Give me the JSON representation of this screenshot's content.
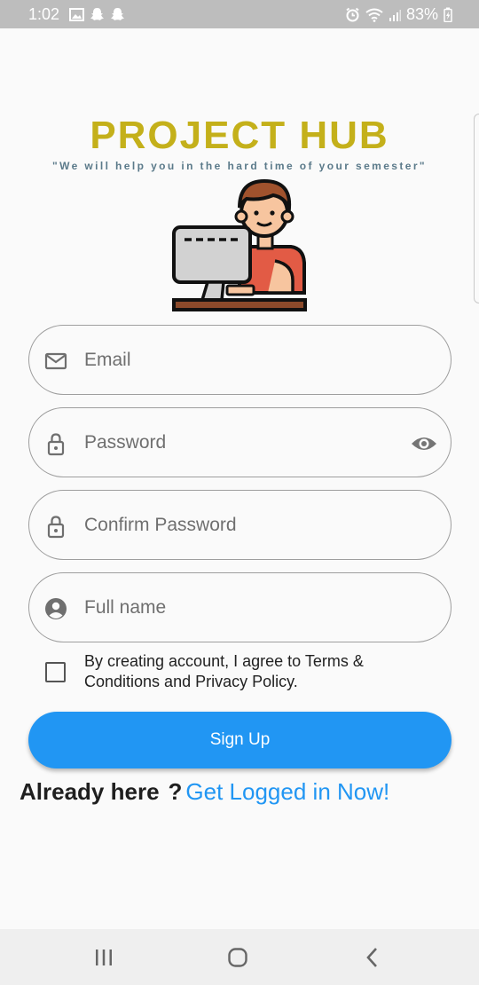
{
  "status_bar": {
    "time": "1:02",
    "battery": "83%",
    "icons_left": [
      "gallery-icon",
      "snapchat-icon",
      "snapchat-icon"
    ],
    "icons_right": [
      "alarm-icon",
      "wifi-icon",
      "signal-icon",
      "battery-charging-icon"
    ]
  },
  "header": {
    "title": "PROJECT HUB",
    "tagline": "\"We will help you in the hard time of your semester\"",
    "title_color": "#c4b01a"
  },
  "form": {
    "email_placeholder": "Email",
    "password_placeholder": "Password",
    "confirm_password_placeholder": "Confirm Password",
    "full_name_placeholder": "Full name",
    "terms_text": "By creating account, I agree to Terms & Conditions and Privacy Policy.",
    "terms_checked": false,
    "signup_label": "Sign Up"
  },
  "login": {
    "prompt": "Already here",
    "question_mark": "?",
    "link_label": "Get Logged in Now!"
  },
  "colors": {
    "accent": "#2196f3",
    "background": "#fafafa"
  }
}
